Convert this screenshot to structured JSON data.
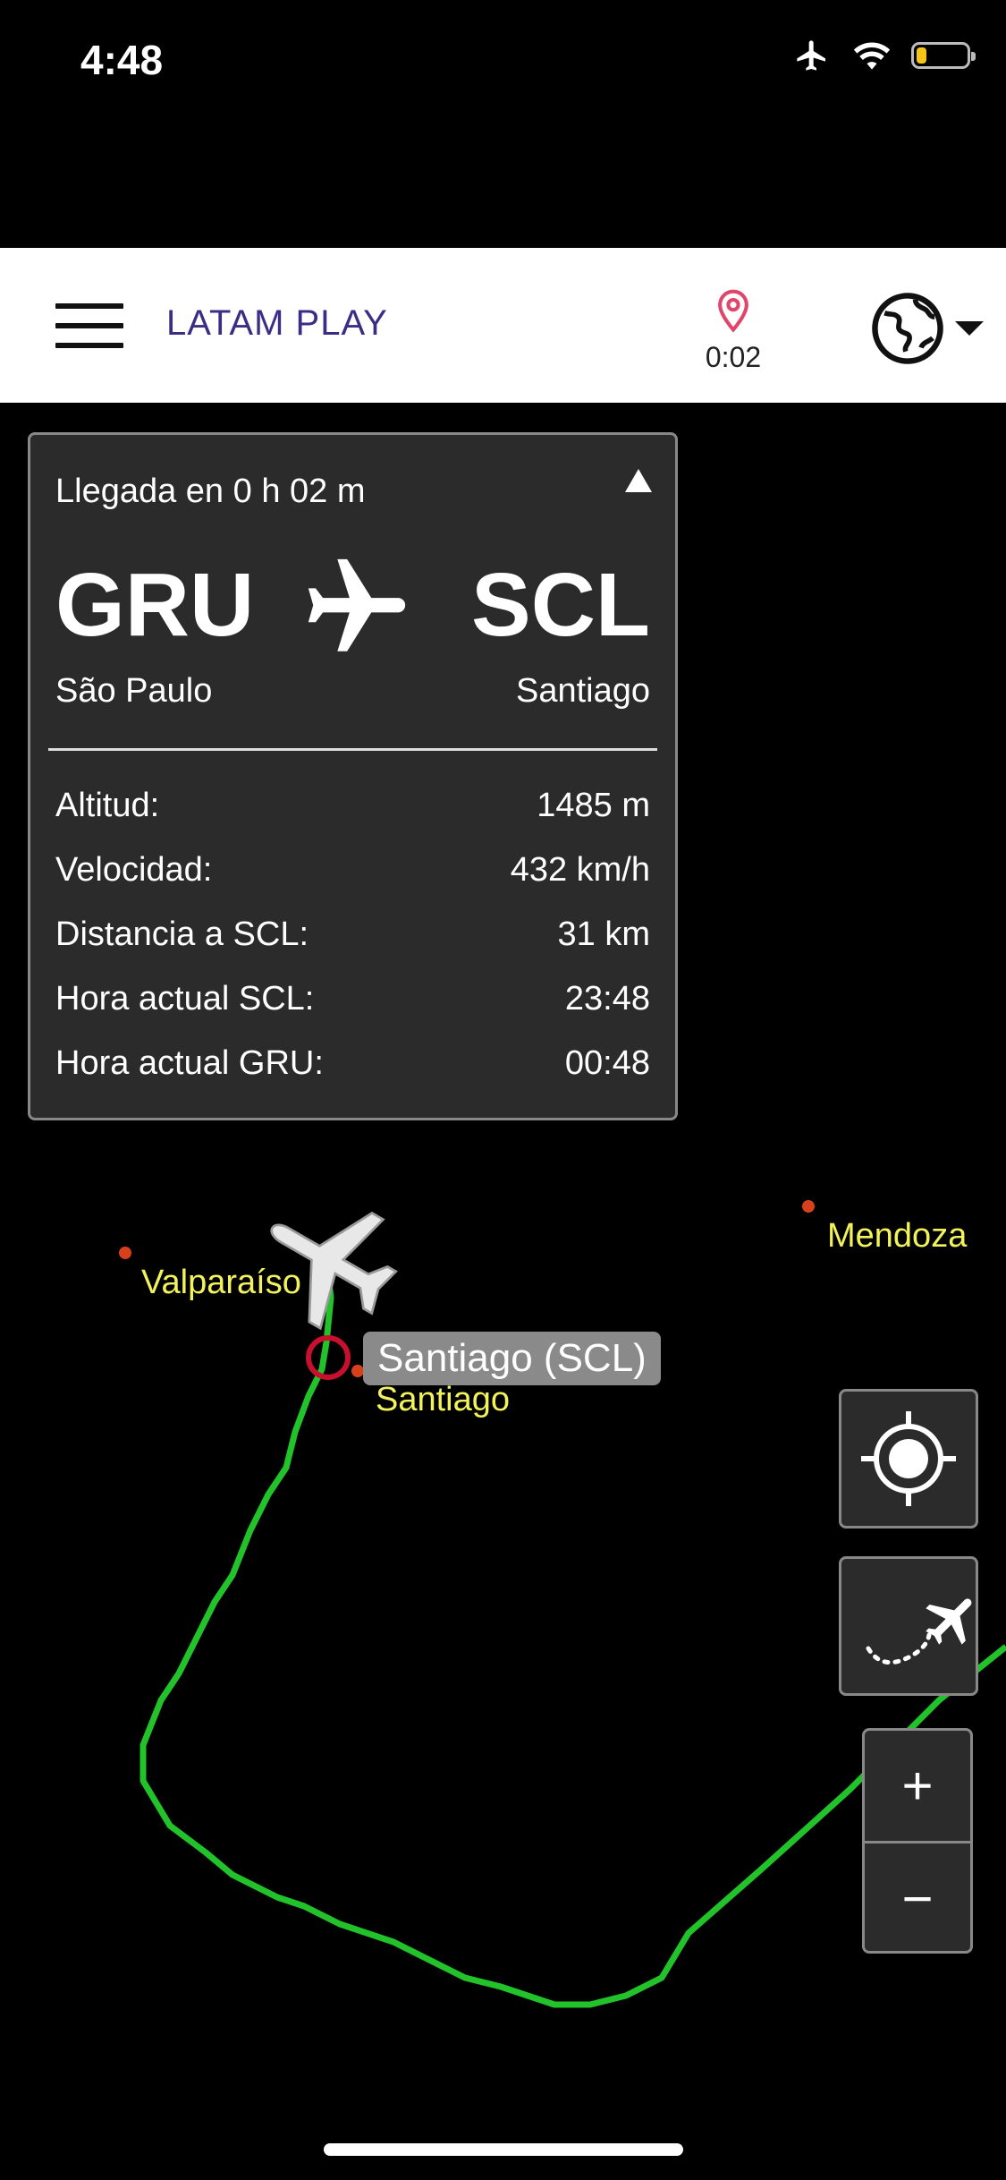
{
  "status": {
    "time": "4:48",
    "battery_level": 0.2
  },
  "header": {
    "brand": "LATAM PLAY",
    "arrival_eta": "0:02"
  },
  "flight": {
    "arrival_text": "Llegada en 0 h 02 m",
    "origin_code": "GRU",
    "origin_city": "São Paulo",
    "dest_code": "SCL",
    "dest_city": "Santiago",
    "stats": [
      {
        "label": "Altitud:",
        "value": "1485 m"
      },
      {
        "label": "Velocidad:",
        "value": "432 km/h"
      },
      {
        "label": "Distancia a SCL:",
        "value": "31 km"
      },
      {
        "label": "Hora actual SCL:",
        "value": "23:48"
      },
      {
        "label": "Hora actual GRU:",
        "value": "00:48"
      }
    ]
  },
  "map": {
    "cities": [
      "Mendoza",
      "Valparaíso",
      "Santiago"
    ],
    "airport_tag": "Santiago (SCL)",
    "route_color": "#22c32a",
    "city_color": "#f2f25a"
  },
  "controls": {
    "zoom_in": "+",
    "zoom_out": "−"
  }
}
